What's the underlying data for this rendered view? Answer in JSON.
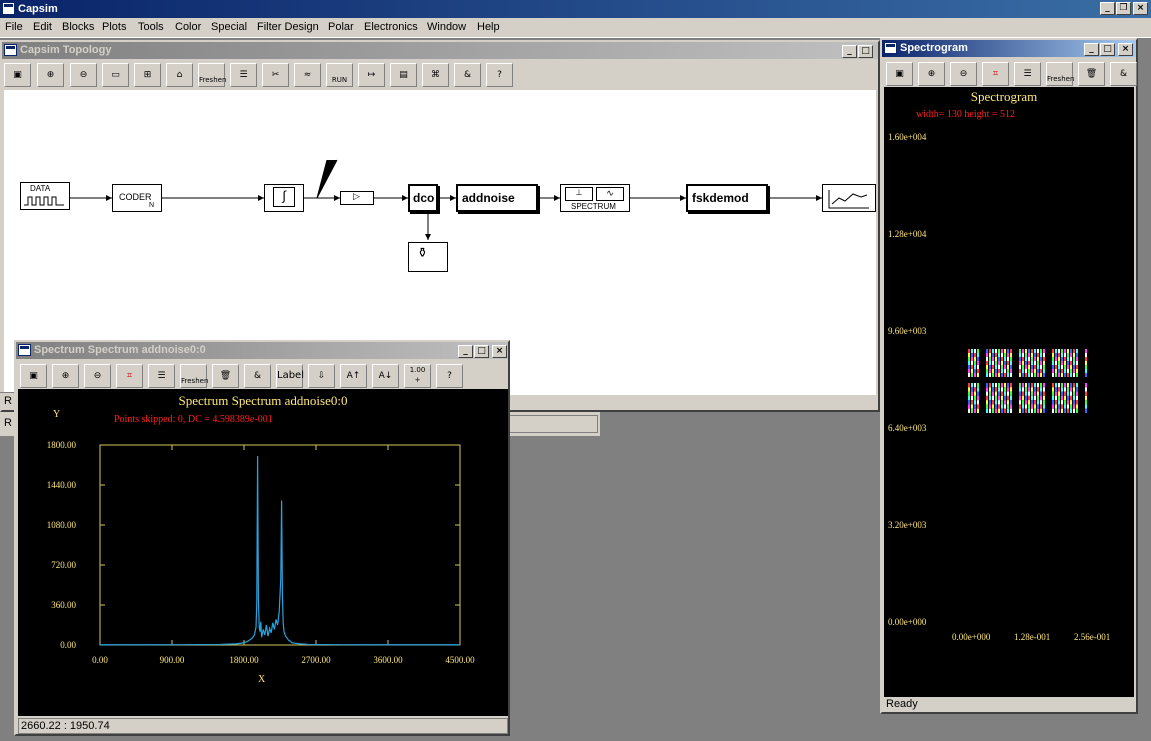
{
  "app": {
    "title": "Capsim"
  },
  "menu": [
    "File",
    "Edit",
    "Blocks",
    "Plots",
    "Tools",
    "Color",
    "Special",
    "Filter Design",
    "Polar",
    "Electronics",
    "Window",
    "Help"
  ],
  "topology": {
    "title": "Capsim Topology",
    "toolbar": {
      "freshen_label": "Freshen",
      "run_label": "RUN",
      "help_label": "?"
    },
    "blocks": {
      "data": "DATA",
      "coder": "CODER",
      "coder_n": "N",
      "dco": "dco",
      "addnoise": "addnoise",
      "spectrum": "SPECTRUM",
      "fskdemod": "fskdemod"
    },
    "side_labels": [
      "R",
      "R"
    ]
  },
  "spectrum_window": {
    "title": "Spectrum Spectrum addnoise0:0",
    "toolbar": {
      "freshen_label": "Freshen",
      "label_label": "Label",
      "scale_label": "1.00",
      "help_label": "?"
    },
    "plot_title": "Spectrum Spectrum addnoise0:0",
    "subtitle": "Points skipped: 0, DC = 4.598389e-001",
    "ylabel": "Y",
    "xlabel": "X",
    "status": "2660.22 : 1950.74"
  },
  "spectrogram_window": {
    "title": "Spectrogram",
    "toolbar": {
      "freshen_label": "Freshen"
    },
    "plot_title": "Spectrogram",
    "subtitle": "width= 130 height = 512",
    "y_ticks": [
      "1.60e+004",
      "1.28e+004",
      "9.60e+003",
      "6.40e+003",
      "3.20e+003",
      "0.00e+000"
    ],
    "x_ticks": [
      "0.00e+000",
      "1.28e-001",
      "2.56e-001"
    ],
    "status": "Ready"
  },
  "colors": {
    "plot_bg": "#000000",
    "trace": "#29a3e0",
    "axis": "#d8c85a",
    "red_text": "#ff2020",
    "tick_text": "#ffe77a"
  },
  "chart_data": {
    "type": "line",
    "title": "Spectrum Spectrum addnoise0:0",
    "xlabel": "X",
    "ylabel": "Y",
    "xlim": [
      0,
      4500
    ],
    "ylim": [
      0,
      1800
    ],
    "x_ticks": [
      "0.00",
      "900.00",
      "1800.00",
      "2700.00",
      "3600.00",
      "4500.00"
    ],
    "y_ticks": [
      "0.00",
      "360.00",
      "720.00",
      "1080.00",
      "1440.00",
      "1800.00"
    ],
    "series": [
      {
        "x": [
          0,
          1000,
          1500,
          1700,
          1800,
          1850,
          1900,
          1930,
          1950,
          1960,
          1970,
          1980,
          1990,
          2000,
          2010,
          2020,
          2040,
          2060,
          2080,
          2100,
          2120,
          2140,
          2160,
          2180,
          2200,
          2220,
          2240,
          2260,
          2270,
          2280,
          2290,
          2300,
          2320,
          2340,
          2360,
          2380,
          2400,
          2450,
          2500,
          2550,
          2600,
          2800,
          3000,
          3500,
          4000,
          4500
        ],
        "y": [
          2,
          3,
          5,
          10,
          20,
          35,
          60,
          90,
          160,
          380,
          1700,
          420,
          160,
          120,
          210,
          70,
          140,
          90,
          180,
          80,
          150,
          110,
          200,
          140,
          230,
          180,
          300,
          600,
          1300,
          450,
          200,
          120,
          80,
          60,
          40,
          35,
          20,
          15,
          10,
          8,
          5,
          4,
          3,
          2,
          2,
          2
        ]
      }
    ]
  }
}
